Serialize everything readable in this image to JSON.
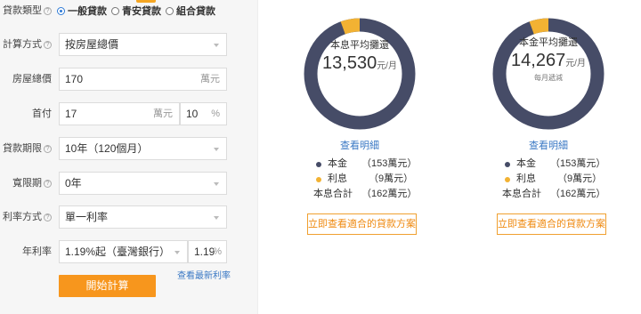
{
  "form": {
    "loan_type_label": "貸款類型",
    "loan_types": [
      "一般貸款",
      "青安貸款",
      "組合貸款"
    ],
    "calc_method_label": "計算方式",
    "calc_method_value": "按房屋總價",
    "house_price_label": "房屋總價",
    "house_price_value": "170",
    "house_price_unit": "萬元",
    "down_payment_label": "首付",
    "down_payment_value": "17",
    "down_payment_unit": "萬元",
    "down_payment_pct": "10",
    "down_payment_pct_unit": "%",
    "term_label": "貸款期限",
    "term_value": "10年（120個月）",
    "grace_label": "寬限期",
    "grace_value": "0年",
    "rate_method_label": "利率方式",
    "rate_method_value": "單一利率",
    "rate_label": "年利率",
    "rate_value": "1.19%起（臺灣銀行）",
    "rate_input": "1.19",
    "rate_unit": "%",
    "latest_rate_link": "查看最新利率",
    "calculate_button": "開始計算"
  },
  "results": [
    {
      "title": "本息平均攤還",
      "amount": "13,530",
      "unit": "元/月",
      "subtitle": "",
      "detail_link": "查看明細",
      "principal_label": "本金",
      "principal_value": "（153萬元）",
      "interest_label": "利息",
      "interest_value": "（9萬元）",
      "total_label": "本息合計",
      "total_value": "（162萬元）",
      "plan_button": "立即查看適合的貸款方案",
      "interest_share": 0.0556
    },
    {
      "title": "本金平均攤還",
      "amount": "14,267",
      "unit": "元/月",
      "subtitle": "每月遞減",
      "detail_link": "查看明細",
      "principal_label": "本金",
      "principal_value": "（153萬元）",
      "interest_label": "利息",
      "interest_value": "（9萬元）",
      "total_label": "本息合計",
      "total_value": "（162萬元）",
      "plan_button": "立即查看適合的貸款方案",
      "interest_share": 0.0556
    }
  ],
  "colors": {
    "principal": "#464c67",
    "interest": "#f2b233",
    "accent_button": "#f7961d",
    "link": "#3a78c4"
  },
  "icons": {
    "help": "question-circle-icon",
    "dropdown": "caret-down-icon",
    "radio": "radio-icon"
  }
}
